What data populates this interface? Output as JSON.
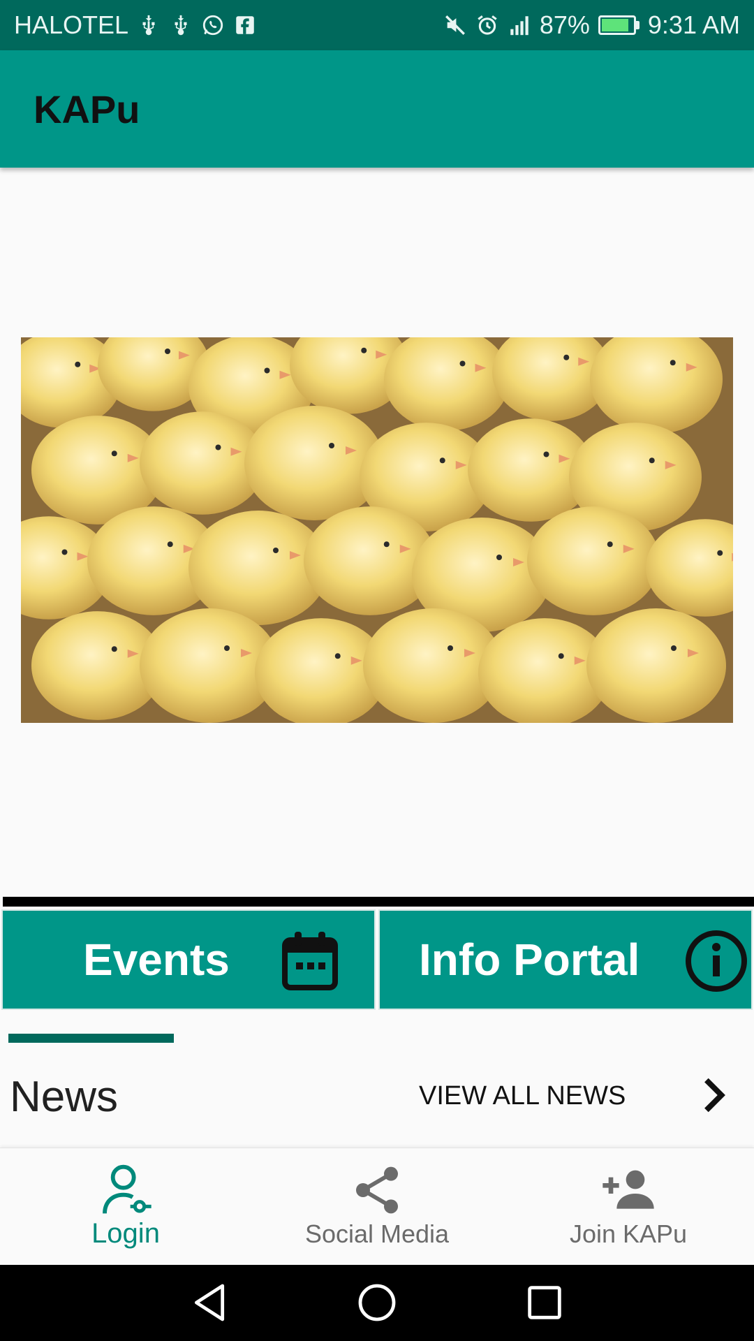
{
  "status_bar": {
    "carrier": "HALOTEL",
    "battery_percent": "87%",
    "battery_level": 0.87,
    "time": "9:31 AM",
    "left_icons": [
      "usb-icon",
      "usb-icon",
      "whatsapp-icon",
      "facebook-icon"
    ],
    "right_icons": [
      "mute-icon",
      "alarm-icon",
      "signal-icon",
      "battery-charging-icon"
    ]
  },
  "app_bar": {
    "title": "KAPu"
  },
  "hero": {
    "image": "chicks-photo"
  },
  "tiles": {
    "events": {
      "label": "Events",
      "icon": "calendar-icon"
    },
    "info_portal": {
      "label": "Info Portal",
      "icon": "info-icon"
    }
  },
  "news": {
    "title": "News",
    "view_all": "VIEW ALL NEWS",
    "chevron_icon": "chevron-right-icon"
  },
  "bottom_nav": {
    "items": [
      {
        "label": "Login",
        "icon": "login-user-icon",
        "active": true
      },
      {
        "label": "Social Media",
        "icon": "share-icon",
        "active": false
      },
      {
        "label": "Join KAPu",
        "icon": "add-person-icon",
        "active": false
      }
    ]
  },
  "system_nav": {
    "buttons": [
      "back-icon",
      "home-icon",
      "recents-icon"
    ]
  },
  "colors": {
    "status_bar": "#00695c",
    "primary": "#009688",
    "accent": "#00897b",
    "background": "#fafafa"
  }
}
